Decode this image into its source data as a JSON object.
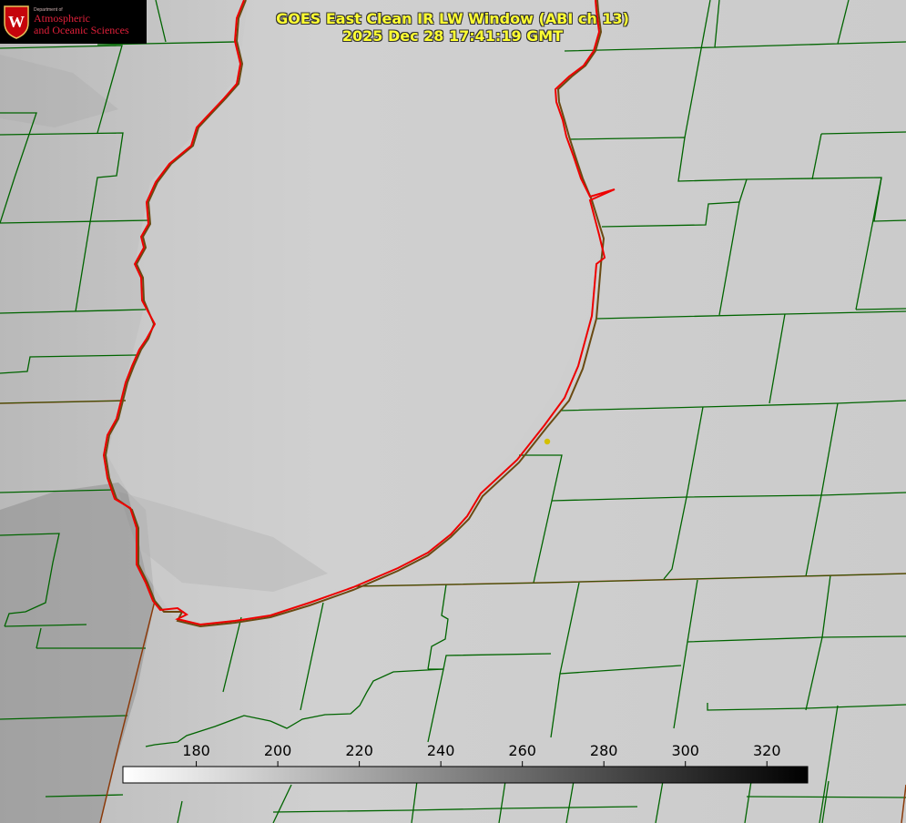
{
  "logo": {
    "dept": "Department of",
    "line1": "Atmospheric",
    "line2": "and Oceanic Sciences",
    "seal_letter": "W",
    "seal_color": "#c5050c"
  },
  "title": {
    "line1": "GOES East Clean IR LW Window (ABI ch 13)",
    "line2": "2025 Dec 28 17:41:19 GMT"
  },
  "colorbar": {
    "min": 162,
    "max": 330,
    "ticks": [
      180,
      200,
      220,
      240,
      260,
      280,
      300,
      320
    ],
    "tick_labels": [
      "180",
      "200",
      "220",
      "240",
      "260",
      "280",
      "300",
      "320"
    ],
    "gradient": [
      "#ffffff",
      "#000000"
    ]
  },
  "colors": {
    "coastline": "#ee0000",
    "coast_shadow": "#7a4a10",
    "county_lines": "#006400",
    "state_lines": "#8b3a0a",
    "marker": "#d4c000",
    "title": "#ffff33"
  }
}
